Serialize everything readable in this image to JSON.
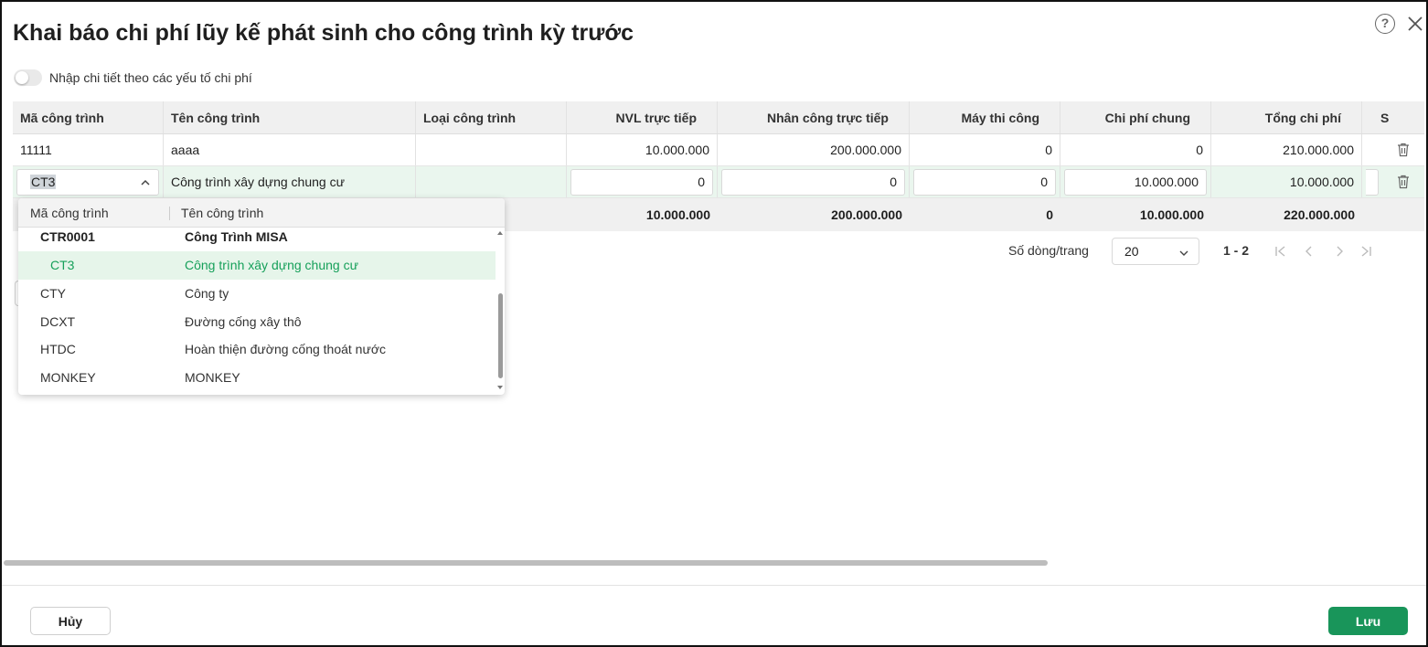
{
  "dialog": {
    "title": "Khai báo chi phí lũy kế phát sinh cho công trình kỳ trước",
    "help_label": "?",
    "toggle_label": "Nhập chi tiết theo các yếu tố chi phí",
    "toggle_on": false
  },
  "grid": {
    "columns": [
      "Mã công trình",
      "Tên công trình",
      "Loại công trình",
      "NVL trực tiếp",
      "Nhân công trực tiếp",
      "Máy thi công",
      "Chi phí chung",
      "Tổng chi phí",
      "S"
    ],
    "rows": [
      {
        "ma": "11111",
        "ten": "aaaa",
        "loai": "",
        "nvl": "10.000.000",
        "nhancong": "200.000.000",
        "may": "0",
        "chung": "0",
        "tong": "210.000.000"
      },
      {
        "ma": "CT3",
        "ten": "Công trình xây dựng chung cư",
        "loai": "",
        "nvl": "0",
        "nhancong": "0",
        "may": "0",
        "chung": "10.000.000",
        "tong": "10.000.000"
      }
    ],
    "totals": {
      "nvl": "10.000.000",
      "nhancong": "200.000.000",
      "may": "0",
      "chung": "10.000.000",
      "tong": "220.000.000"
    }
  },
  "dropdown": {
    "columns": [
      "Mã công trình",
      "Tên công trình"
    ],
    "items": [
      {
        "code": "CTR0001",
        "name": "Công Trình MISA",
        "group": true
      },
      {
        "code": "CT3",
        "name": "Công trình xây dựng chung cư",
        "selected": true
      },
      {
        "code": "CTY",
        "name": "Công ty"
      },
      {
        "code": "DCXT",
        "name": "Đường cống xây thô"
      },
      {
        "code": "HTDC",
        "name": "Hoàn thiện đường cống thoát nước"
      },
      {
        "code": "MONKEY",
        "name": "MONKEY"
      }
    ]
  },
  "pager": {
    "rows_label": "Số dòng/trang",
    "page_size": "20",
    "range": "1 - 2"
  },
  "footer": {
    "cancel_label": "Hủy",
    "save_label": "Lưu"
  },
  "colors": {
    "accent": "#19955a",
    "selected_row_bg": "#eaf6ee",
    "header_bg": "#f0f0f0"
  }
}
